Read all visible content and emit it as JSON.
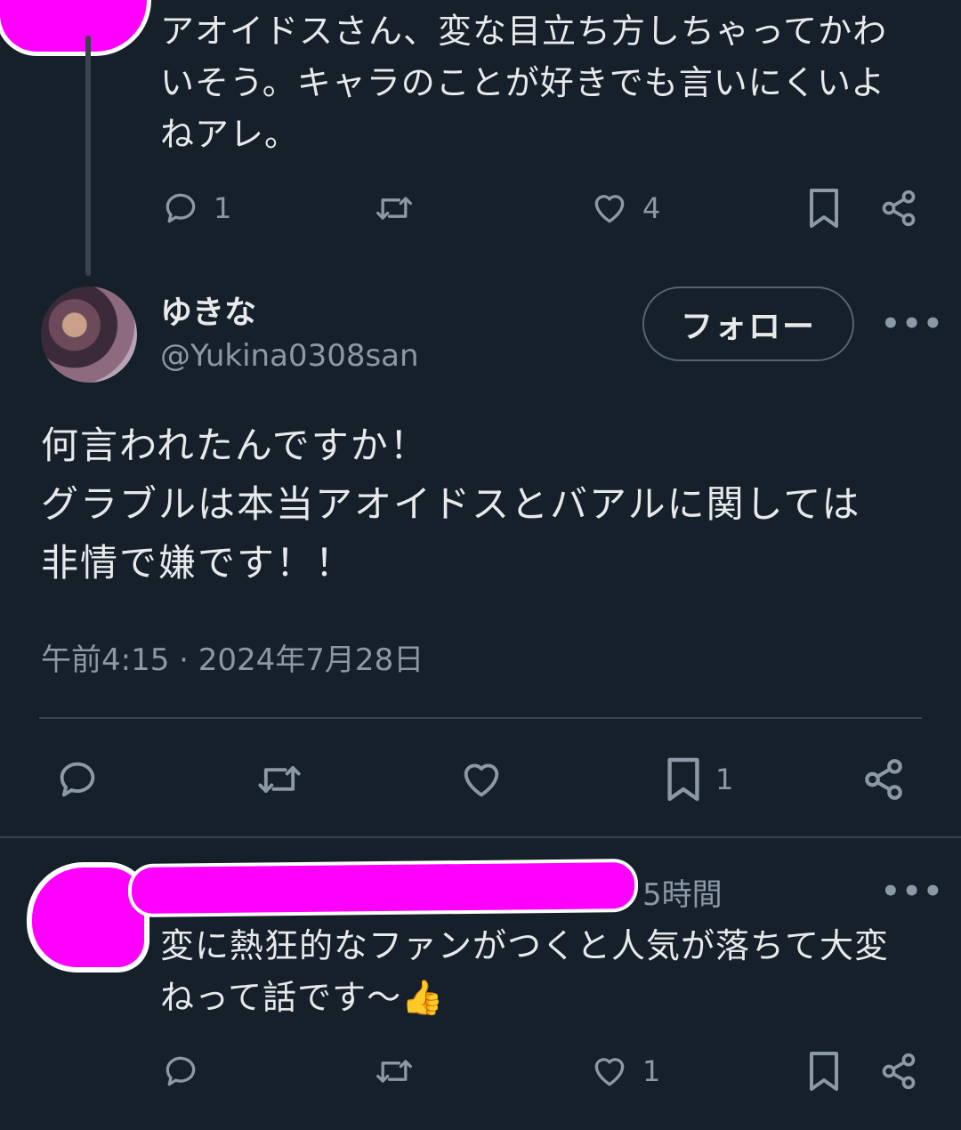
{
  "previous_post": {
    "text_lines": [
      "アオイドスさん、変な目立ち方しちゃってかわ",
      "いそう。キャラのことが好きでも言いにくいよ",
      "ねアレ。"
    ],
    "reply_count": "1",
    "repost_count": "",
    "like_count": "4"
  },
  "main_post": {
    "display_name": "ゆきな",
    "handle": "@Yukina0308san",
    "follow_label": "フォロー",
    "more_label": "•••",
    "text_lines": [
      "何言われたんですか！",
      "グラブルは本当アオイドスとバアルに関しては",
      "非情で嫌です！！"
    ],
    "timestamp": "午前4:15 · 2024年7月28日",
    "bookmark_count": "1"
  },
  "reply_post": {
    "time_ago": "5時間",
    "more_label": "•••",
    "text_lines": [
      "変に熱狂的なファンがつくと人気が落ちて大変",
      "ねって話です〜👍"
    ],
    "like_count": "1"
  },
  "colors": {
    "background": "#15202b",
    "text": "#e7e9ea",
    "muted": "#8b98a5",
    "divider": "#38444d",
    "redaction": "#ff00ff"
  },
  "icons": [
    "reply-icon",
    "repost-icon",
    "like-icon",
    "bookmark-icon",
    "share-icon",
    "more-icon"
  ]
}
